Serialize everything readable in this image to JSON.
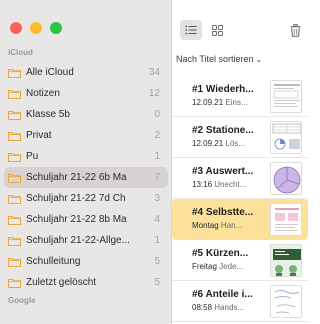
{
  "sidebar": {
    "section_icloud": "iCloud",
    "section_google": "Google",
    "folders": [
      {
        "name": "Alle iCloud",
        "count": "34"
      },
      {
        "name": "Notizen",
        "count": "12"
      },
      {
        "name": "Klasse 5b",
        "count": "0"
      },
      {
        "name": "Privat",
        "count": "2"
      },
      {
        "name": "Pu",
        "count": "1"
      },
      {
        "name": "Schuljahr 21-22 6b Ma",
        "count": "7"
      },
      {
        "name": "Schuljahr 21-22 7d Ch",
        "count": "3"
      },
      {
        "name": "Schuljahr 21-22 8b Ma",
        "count": "4"
      },
      {
        "name": "Schuljahr 21-22-Allge...",
        "count": "1"
      },
      {
        "name": "Schulleitung",
        "count": "5"
      },
      {
        "name": "Zuletzt gelöscht",
        "count": "5"
      }
    ],
    "selected_index": 5
  },
  "toolbar": {
    "list_view_icon": "list-icon",
    "gallery_view_icon": "grid-icon",
    "trash_icon": "trash-icon"
  },
  "sort_label": "Nach Titel sortieren",
  "notes": [
    {
      "title": "#1 Wiederh...",
      "date": "12.09.21",
      "preview": "Eins..."
    },
    {
      "title": "#2 Statione...",
      "date": "12.09.21",
      "preview": "Lös..."
    },
    {
      "title": "#3 Auswert...",
      "date": "13:16",
      "preview": "Unecht..."
    },
    {
      "title": "#4 Selbstte...",
      "date": "Montag",
      "preview": "Han..."
    },
    {
      "title": "#5 Kürzen...",
      "date": "Freitag",
      "preview": "Jede..."
    },
    {
      "title": "#6 Anteile i...",
      "date": "08:58",
      "preview": "Hands..."
    }
  ],
  "selected_note_index": 3,
  "colors": {
    "sidebar_bg": "#e9e7e6",
    "folder_icon": "#e8a93a",
    "selected_note": "#fbe19a",
    "selected_folder": "#d6d3d2"
  }
}
